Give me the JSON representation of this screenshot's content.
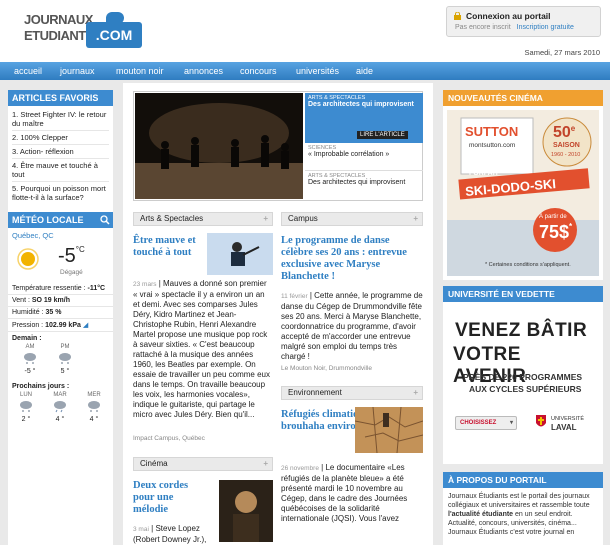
{
  "logo": {
    "line1": "JOURNAUX",
    "line2": "ETUDIANTS",
    "com": ".COM"
  },
  "login": {
    "title": "Connexion au portail",
    "not_registered": "Pas encore inscrit",
    "signup": "Inscription gratuite"
  },
  "date": "Samedi, 27 mars 2010",
  "nav": [
    "accueil",
    "journaux",
    "mouton noir",
    "annonces",
    "concours",
    "universités",
    "aide"
  ],
  "favorites": {
    "title": "ARTICLES FAVORIS",
    "items": [
      "1. Street Fighter IV: le retour du maître",
      "2. 100% Clepper",
      "3. Action- réflexion",
      "4. Être mauve et touché à tout",
      "5. Pourquoi un poisson mort flotte-t-il à la surface?"
    ]
  },
  "weather": {
    "title": "MÉTÉO LOCALE",
    "city": "Québec, QC",
    "temp": "-5",
    "unit": "°C",
    "condition": "Dégagé",
    "felt_label": "Température ressentie :",
    "felt_value": "-11°C",
    "wind_label": "Vent :",
    "wind_value": "SO 19 km/h",
    "humidity_label": "Humidité :",
    "humidity_value": "35 %",
    "pressure_label": "Pression :",
    "pressure_value": "102.99 kPa",
    "tomorrow_label": "Demain :",
    "tomorrow": [
      {
        "day": "AM",
        "temp": "-5 °"
      },
      {
        "day": "PM",
        "temp": "5 °"
      }
    ],
    "next_label": "Prochains jours :",
    "next": [
      {
        "day": "LUN",
        "temp": "2 °"
      },
      {
        "day": "MAR",
        "temp": "4 °"
      },
      {
        "day": "MER",
        "temp": "4 °"
      }
    ]
  },
  "feature": {
    "items": [
      {
        "category": "ARTS & SPECTACLES",
        "title": "Des architectes qui improvisent",
        "read": "LIRE L'ARTICLE"
      },
      {
        "category": "SCIENCES",
        "title": "« Improbable corrélation »"
      },
      {
        "category": "ARTS & SPECTACLES",
        "title": "Des architectes qui improvisent"
      }
    ]
  },
  "arts": {
    "section": "Arts & Spectacles",
    "title": "Être mauve et touché à tout",
    "date": "23 mars",
    "body": "Mauves a donné son premier « vrai » spectacle il y a environ un an et demi. Avec ses comparses Jules Déry, Kidro Martinez et Jean-Christophe Rubin, Henri Alexandre Martel propose une musique pop rock à saveur sixties. « C'est beaucoup rattaché à la musique des années 1960, les Beatles par exemple. On essaie de travailler un peu comme eux dans le temps. On travaille beaucoup les voix, les harmonies vocales», indique le guitariste, qui partage le micro avec Jules Déry. Bien qu'il...",
    "source": "Impact Campus, Québec"
  },
  "campus": {
    "section": "Campus",
    "title": "Le programme de danse célèbre ses 20 ans : entrevue exclusive avec Maryse Blanchette !",
    "date": "11 février",
    "body": "Cette année, le programme de danse du Cégep de Drummondville fête ses 20 ans. Merci à Maryse Blanchette, coordonnatrice du programme, d'avoir accepté de m'accorder une entrevue malgré son emploi du temps très chargé !",
    "source": "Le Mouton Noir, Drummondville"
  },
  "environnement": {
    "section": "Environnement",
    "title": "Réfugiés climatiques et brouhaha environnemental",
    "date": "26 novembre",
    "body": "Le documentaire «Les réfugiés de la planète bleue» a été présenté mardi le 10 novembre au Cégep, dans le cadre des Journées québécoises de la solidarité internationale (JQSI). Vous l'avez"
  },
  "cinema": {
    "section": "Cinéma",
    "title": "Deux cordes pour une mélodie",
    "date": "3 mai",
    "body": "Steve Lopez (Robert Downey Jr.),"
  },
  "cinema_ad": {
    "title": "NOUVEAUTÉS CINÉMA",
    "brand": "SUTTON",
    "site": "montsutton.com",
    "season_num": "50",
    "season_e": "e",
    "season_word": "SAISON",
    "years": "1960 - 2010",
    "forfait": "FORFAIT",
    "slogan": "SKI-DODO-SKI",
    "apartir": "À partir de",
    "price": "75$",
    "price_star": "*",
    "cond": "* Certaines conditions s'appliquent."
  },
  "univ": {
    "title": "UNIVERSITÉ EN VEDETTE",
    "line1": "VENEZ BÂTIR",
    "line2": "VOTRE AVENIR",
    "line3": "PRÈS DE 220 PROGRAMMES",
    "line4": "AUX CYCLES SUPÉRIEURS",
    "button": "CHOISISSEZ",
    "uni_top": "UNIVERSITÉ",
    "uni_bottom": "LAVAL"
  },
  "propos": {
    "title": "À PROPOS DU PORTAIL",
    "text_a": "Journaux Étudiants est le portail des journaux collégiaux et universitaires et rassemble toute ",
    "text_bold": "l'actualité étudiante",
    "text_b": " en un seul endroit. Actualité, concours, universités, cinéma... Journaux Étudiants c'est votre journal en"
  }
}
